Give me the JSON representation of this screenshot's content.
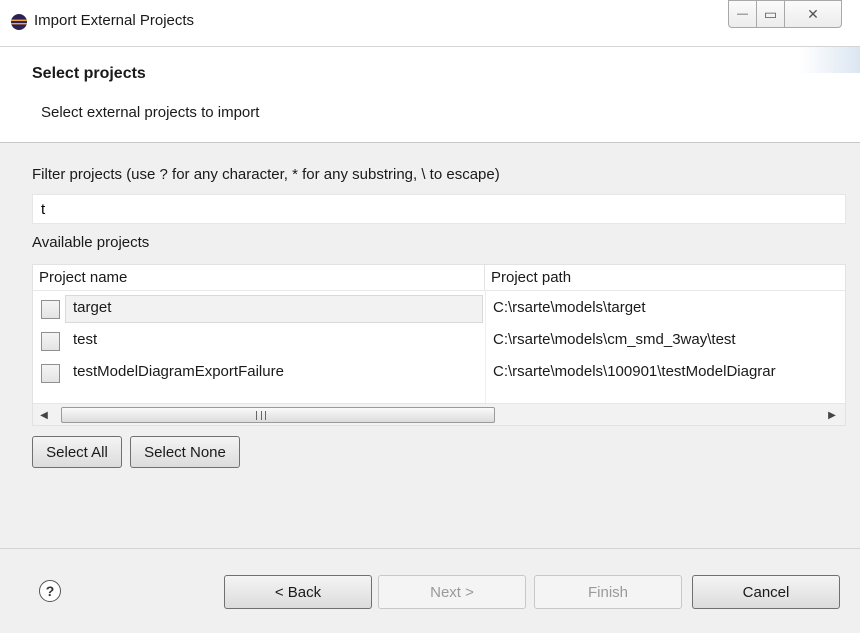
{
  "window": {
    "title": "Import External Projects",
    "minimize_glyph": "—",
    "maximize_glyph": "▭",
    "close_glyph": "✕"
  },
  "header": {
    "title": "Select projects",
    "description": "Select external projects to import"
  },
  "filter": {
    "label": "Filter projects (use ? for any character, * for any substring, \\ to escape)",
    "value": "t"
  },
  "available": {
    "label": "Available projects",
    "columns": [
      "Project name",
      "Project path"
    ],
    "rows": [
      {
        "name": "target",
        "path": "C:\\rsarte\\models\\target",
        "checked": false,
        "selected": true
      },
      {
        "name": "test",
        "path": "C:\\rsarte\\models\\cm_smd_3way\\test",
        "checked": false,
        "selected": false
      },
      {
        "name": "testModelDiagramExportFailure",
        "path": "C:\\rsarte\\models\\100901\\testModelDiagrar",
        "checked": false,
        "selected": false
      }
    ],
    "scroll_left_glyph": "◀",
    "scroll_right_glyph": "▶"
  },
  "selection_buttons": {
    "select_all": "Select All",
    "select_none": "Select None"
  },
  "footer": {
    "help_glyph": "?",
    "back": "< Back",
    "next": "Next >",
    "finish": "Finish",
    "cancel": "Cancel"
  },
  "icons": {
    "app": "eclipse-icon",
    "help": "help-icon"
  },
  "colors": {
    "window_bg": "#f0f0f0",
    "banner_bg": "#ffffff",
    "disabled_text": "#9a9a9a"
  }
}
